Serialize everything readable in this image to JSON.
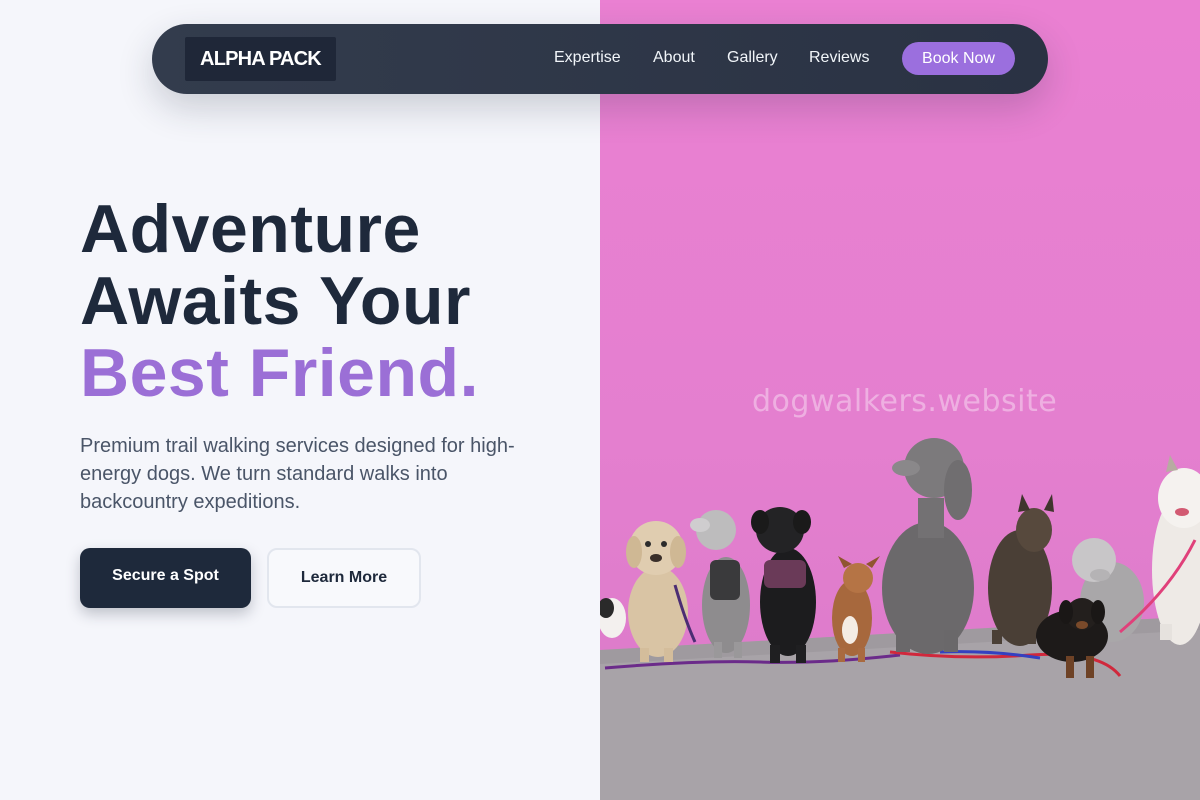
{
  "brand": {
    "logo_text": "ALPHA PACK"
  },
  "nav": {
    "links": [
      "Expertise",
      "About",
      "Gallery",
      "Reviews"
    ],
    "cta_label": "Book Now"
  },
  "hero": {
    "headline_line1": "Adventure",
    "headline_line2": "Awaits Your",
    "headline_accent": "Best Friend.",
    "subtitle": "Premium trail walking services designed for high-energy dogs. We turn standard walks into backcountry expeditions.",
    "primary_button": "Secure a Spot",
    "secondary_button": "Learn More"
  },
  "photo": {
    "description_icon": "dogs-photo",
    "watermark": "dogwalkers.website"
  },
  "colors": {
    "accent": "#9b6fd6",
    "dark": "#1e293b",
    "wall_pink": "#e47fcf",
    "background": "#f5f6fb"
  }
}
